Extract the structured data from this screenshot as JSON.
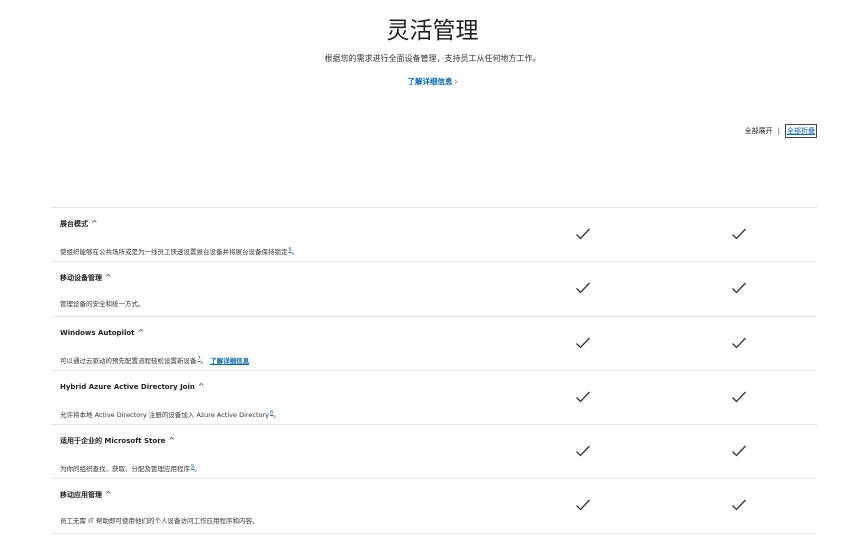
{
  "hero": {
    "title": "灵活管理",
    "subtitle": "根据您的需求进行全面设备管理，支持员工从任何地方工作。",
    "learn_more": "了解详细信息",
    "learn_more_chevron": "›"
  },
  "controls": {
    "expand_all": "全部展开",
    "separator": "|",
    "collapse_all": "全部折叠"
  },
  "features": [
    {
      "title": "展台模式",
      "caret": "^",
      "desc": "使组织能够在公共场所或是为一线员工快速设置展台设备并将展台设备保持锁定",
      "footnote": "6",
      "suffix": "。",
      "link": "",
      "col1": "check-icon",
      "col2": "check-icon"
    },
    {
      "title": "移动设备管理",
      "caret": "^",
      "desc": "管理设备的安全和统一方式。",
      "footnote": "",
      "suffix": "",
      "link": "",
      "col1": "check-icon",
      "col2": "check-icon"
    },
    {
      "title": "Windows Autopilot",
      "caret": "^",
      "desc": "可以通过云驱动的预先配置流程轻松设置新设备",
      "footnote": "7",
      "suffix": "。",
      "link": "了解详细信息",
      "col1": "check-icon",
      "col2": "check-icon"
    },
    {
      "title": "Hybrid Azure Active Directory Join",
      "caret": "^",
      "desc": "允许将本地 Active Directory 注册的设备加入 Azure Active Directory",
      "footnote": "8",
      "suffix": "。",
      "link": "",
      "col1": "check-icon",
      "col2": "check-icon"
    },
    {
      "title": "适用于企业的 Microsoft Store",
      "caret": "^",
      "desc": "为你的组织查找、获取、分配及管理应用程序",
      "footnote": "9",
      "suffix": "。",
      "link": "",
      "col1": "check-icon",
      "col2": "check-icon"
    },
    {
      "title": "移动应用管理",
      "caret": "^",
      "desc": "员工无需 IT 帮助即可使用他们的个人设备访问工作应用程序和内容。",
      "footnote": "",
      "suffix": "",
      "link": "",
      "col1": "check-icon",
      "col2": "check-icon"
    }
  ]
}
